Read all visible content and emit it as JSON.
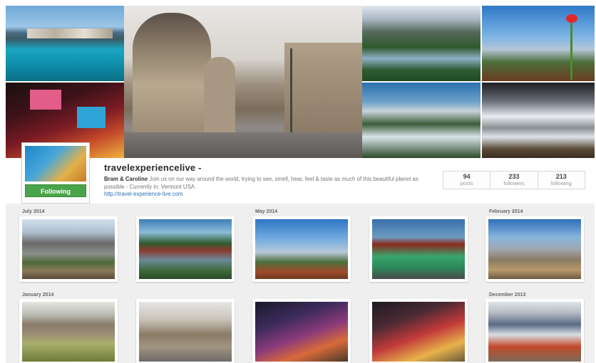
{
  "profile": {
    "username": "travelexperiencelive -",
    "follow_label": "Following",
    "bio_author": "Bram & Caroline",
    "bio_text": "Join us on our way around the world, trying to see, smell, hear, feel & taste as much of this beautiful planet as possible - Currently in: Vermont USA",
    "website": "http://travel-experience-live.com"
  },
  "stats": [
    {
      "count": "94",
      "label": "posts"
    },
    {
      "count": "233",
      "label": "followers"
    },
    {
      "count": "213",
      "label": "following"
    }
  ],
  "timeline": {
    "row1_months": [
      "July 2014",
      "May 2014",
      "February 2014"
    ],
    "row2_months": [
      "January 2014",
      "December 2013"
    ]
  },
  "colors": {
    "follow_button": "#4aa44a",
    "link": "#2b6fb3",
    "grid_background": "#efefef"
  }
}
